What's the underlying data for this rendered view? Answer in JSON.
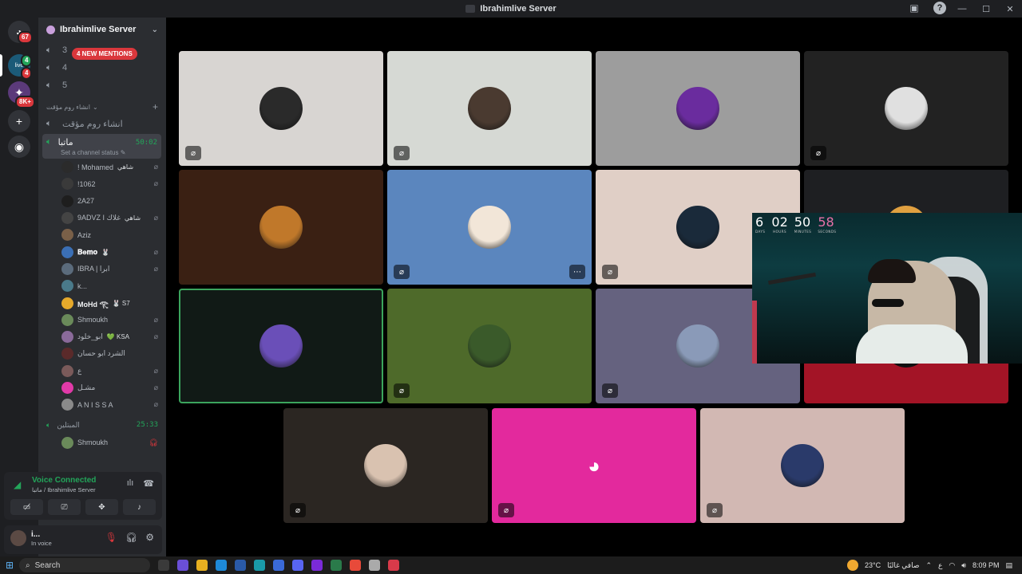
{
  "window": {
    "title": "Ibrahimlive Server",
    "controls": [
      "—",
      "☐",
      "✕"
    ]
  },
  "rail": {
    "home_badge": "67",
    "server_badge": "4",
    "server_badge2": "4",
    "other_badge": "8K+",
    "add_label": "+",
    "discover_label": "◉"
  },
  "sidebar": {
    "server_name": "Ibrahimlive Server",
    "mentions_pill": "4 NEW MENTIONS",
    "voice_channels_top": [
      "3",
      "4",
      "5"
    ],
    "category": "انشاء روم مؤقت",
    "create_channel": "انشاء روم مؤقت",
    "active_channel": {
      "name": "ماتبا",
      "timer": "50:02",
      "status": "Set a channel status"
    },
    "members": [
      {
        "name": "! Mohamed",
        "tag": "شاهي",
        "color": "#2b2b2b",
        "muted": true,
        "bold": false
      },
      {
        "name": "!1062",
        "tag": "",
        "color": "#3a3a3a",
        "muted": true,
        "bold": false
      },
      {
        "name": "2A27",
        "tag": "",
        "color": "#1e1e1e",
        "muted": false,
        "bold": false
      },
      {
        "name": "9ADVZ I غلاك",
        "tag": "شاهي",
        "color": "#444",
        "muted": true,
        "bold": false
      },
      {
        "name": "Aziz",
        "tag": "",
        "color": "#7a6048",
        "muted": false,
        "bold": false
      },
      {
        "name": "𝐁𝐞𝐦𝐨",
        "tag": "🐰",
        "color": "#3b6fb5",
        "muted": true,
        "bold": true
      },
      {
        "name": "IBRA | ابرا",
        "tag": "",
        "color": "#5b6b7c",
        "muted": true,
        "bold": false
      },
      {
        "name": "k...",
        "tag": "",
        "color": "#4a7a8a",
        "muted": false,
        "bold": false
      },
      {
        "name": "MoHd 𓂀",
        "tag": "🐰 S7",
        "color": "#e6a92b",
        "muted": false,
        "bold": true
      },
      {
        "name": "Shmoukh",
        "tag": "",
        "color": "#6a8a5a",
        "muted": true,
        "bold": false
      },
      {
        "name": "ابو_خلود",
        "tag": "💚 KSA",
        "color": "#8a6a9a",
        "muted": true,
        "bold": false
      },
      {
        "name": "الشرد ابو حسان",
        "tag": "",
        "color": "#5a2a2a",
        "muted": false,
        "bold": false
      },
      {
        "name": "ع",
        "tag": "",
        "color": "#7a5a5a",
        "muted": true,
        "bold": false
      },
      {
        "name": "مشـل",
        "tag": "",
        "color": "#e13aa8",
        "muted": true,
        "bold": false
      },
      {
        "name": "A N I S S A",
        "tag": "",
        "color": "#8a8a8a",
        "muted": true,
        "bold": false
      }
    ],
    "second_channel": {
      "name": "المبتلين",
      "timer": "25:33"
    },
    "second_member": {
      "name": "Shmoukh"
    }
  },
  "voice_panel": {
    "title": "Voice Connected",
    "subtitle": "ماتبا / Ibrahimlive Server"
  },
  "user_panel": {
    "name": "i...",
    "status": "In voice"
  },
  "tiles": [
    {
      "bg": "#d8d5d2",
      "avatar": "#2a2a2a",
      "mute": true,
      "more": false
    },
    {
      "bg": "#d6d9d4",
      "avatar": "#4a3a30",
      "mute": true,
      "more": false
    },
    {
      "bg": "#9d9d9d",
      "avatar": "#6a2c9e",
      "mute": false,
      "more": false
    },
    {
      "bg": "#222222",
      "avatar": "#e0e0e0",
      "mute": true,
      "more": false
    },
    {
      "bg": "#3a2013",
      "avatar": "#c0782a",
      "mute": false,
      "more": false
    },
    {
      "bg": "#5b86be",
      "avatar": "#f2e6d8",
      "mute": true,
      "more": true
    },
    {
      "bg": "#e0cfc6",
      "avatar": "#1a2a3a",
      "mute": true,
      "more": false
    },
    {
      "bg": "#1e1f22",
      "avatar": "#e0a040",
      "mute": false,
      "more": false
    },
    {
      "bg": "#111a16",
      "avatar": "#6a4fb8",
      "mute": false,
      "more": false,
      "speaking": true
    },
    {
      "bg": "#4e6a2a",
      "avatar": "#3a5a2a",
      "mute": true,
      "more": false
    },
    {
      "bg": "#65627f",
      "avatar": "#8a9ab8",
      "mute": true,
      "more": false
    },
    {
      "bg": "#a31426",
      "avatar": "#111",
      "mute": false,
      "more": false
    },
    {
      "bg": "#2b2622",
      "avatar": "#d9c2b0",
      "mute": true,
      "more": false
    },
    {
      "bg": "#e3299d",
      "avatar": "#e3299d",
      "mute": true,
      "more": false,
      "discord": true
    },
    {
      "bg": "#d2b8b3",
      "avatar": "#2a3a6a",
      "mute": true,
      "more": false
    }
  ],
  "stream": {
    "timer": [
      {
        "value": "6",
        "label": "DAYS",
        "pink": false
      },
      {
        "value": "02",
        "label": "HOURS",
        "pink": false
      },
      {
        "value": "50",
        "label": "MINUTES",
        "pink": false
      },
      {
        "value": "58",
        "label": "SECONDS",
        "pink": true
      }
    ]
  },
  "taskbar": {
    "search": "Search",
    "weather": "23°C",
    "weather_desc": "صافي غالبًا",
    "lang": "ع",
    "time": "8:09 PM"
  }
}
